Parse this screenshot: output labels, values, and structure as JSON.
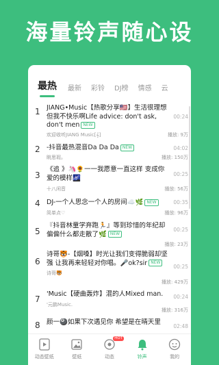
{
  "headline": "海量铃声随心设",
  "tabs": [
    "最热",
    "最新",
    "彩铃",
    "DJ榜",
    "情感",
    "云"
  ],
  "new_badge": "NEW",
  "songs": [
    {
      "rank": "1",
      "title": "JIANG•Music【热歌分享🇺🇸】生活很理想但我不快乐啊Life advice: don't ask, don't men",
      "has_new": true,
      "sub": "欢迎收听JIANG  Music[𝄞]",
      "duration": "00:24",
      "plays": "播放: 9万"
    },
    {
      "rank": "2",
      "title": "-抖音最热混音Da Da Da",
      "has_new": true,
      "sub": "眺思瑕。",
      "duration": "04:02",
      "plays": "播放: 150万"
    },
    {
      "rank": "3",
      "title": "《追 》🦄🌻一一我愿意一直这样 变成你爱的模样🌌",
      "has_new": false,
      "sub": "十八闲音",
      "duration": "00:25",
      "plays": "播放: 56万"
    },
    {
      "rank": "4",
      "title": "DJ-一个人思念一个人的房间☁️🌿",
      "has_new": true,
      "sub": "简单点♡",
      "duration": "00:35",
      "plays": "播放: 96万"
    },
    {
      "rank": "5",
      "title": "『抖音林童学弃跑🏃』等到珍惜的年纪却偏偏什么都走散了🌿",
      "has_new": true,
      "sub": "",
      "duration": "00:25",
      "plays": "播放: 23万"
    },
    {
      "rank": "6",
      "title": "诗哥🐯-【烟嗓】时光让我们变得脆弱却坚强 让我再来轻轻对你唱。🎤ok?sir",
      "has_new": true,
      "sub": "诗哥🐯",
      "duration": "00:25",
      "plays": "播放: 429万"
    },
    {
      "rank": "7",
      "title": "'Music【硬曲轰炸】混的人Mixed man.",
      "has_new": false,
      "sub": "'元鹏Music.",
      "duration": "00:24",
      "plays": "播放: 316万"
    },
    {
      "rank": "8",
      "title": "颜一🎱如果下次遇见你 希望是在晴天里",
      "has_new": false,
      "sub": "",
      "duration": "02:48",
      "plays": ""
    }
  ],
  "bottom_nav": [
    {
      "label": "动态壁纸",
      "icon": "video-wallpaper-icon"
    },
    {
      "label": "壁纸",
      "icon": "image-wallpaper-icon"
    },
    {
      "label": "动态",
      "icon": "feed-icon",
      "badge": "HOT"
    },
    {
      "label": "铃声",
      "icon": "bell-icon",
      "active": true
    },
    {
      "label": "我的",
      "icon": "profile-icon"
    }
  ],
  "colors": {
    "brand": "#3dbe7e",
    "hot": "#ff4d4d"
  }
}
